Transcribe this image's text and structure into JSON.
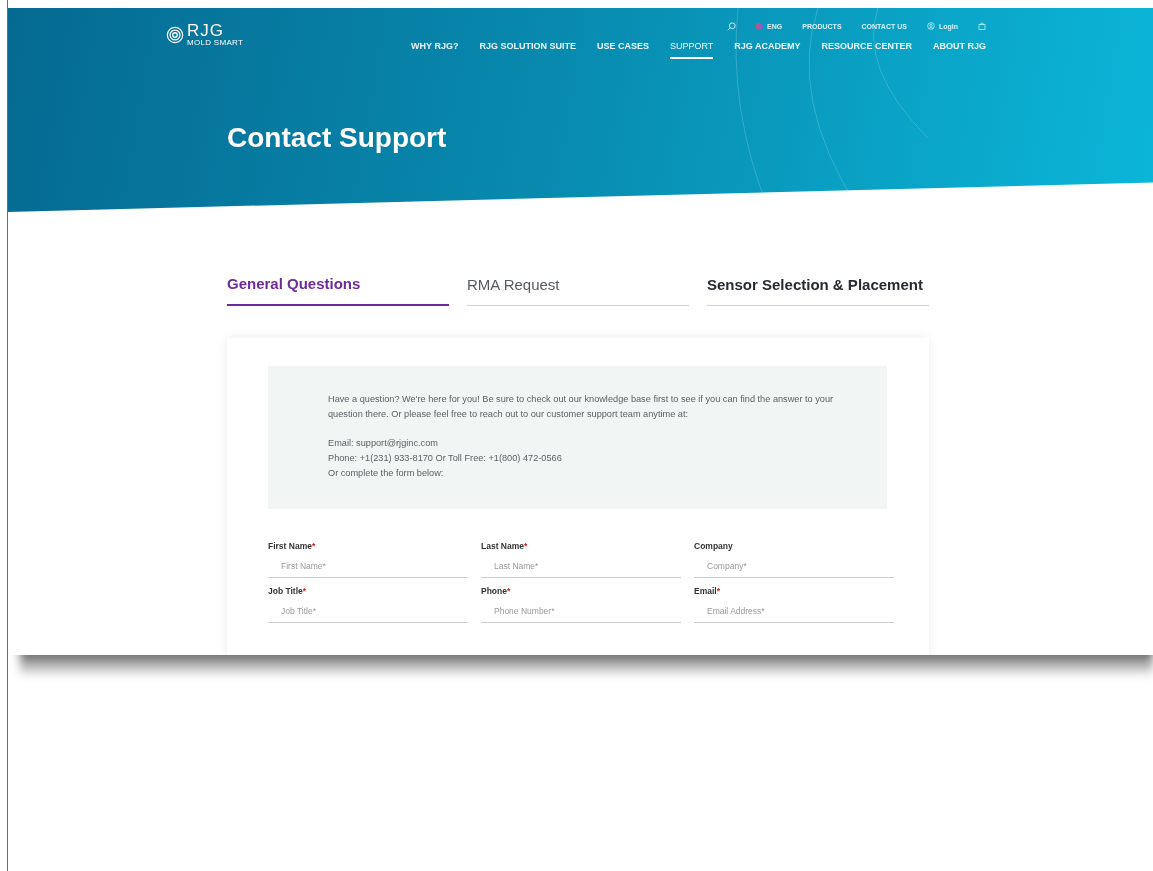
{
  "header": {
    "logo": {
      "name": "RJG",
      "tagline": "MOLD SMART"
    },
    "utility": [
      {
        "kind": "search"
      },
      {
        "kind": "language",
        "label": "ENG"
      },
      {
        "kind": "link",
        "label": "PRODUCTS"
      },
      {
        "kind": "link",
        "label": "CONTACT US"
      },
      {
        "kind": "login",
        "label": "Login"
      },
      {
        "kind": "cart"
      }
    ],
    "nav": [
      {
        "label": "WHY RJG?",
        "selected": false
      },
      {
        "label": "RJG SOLUTION SUITE",
        "selected": false
      },
      {
        "label": "USE CASES",
        "selected": false
      },
      {
        "label": "SUPPORT",
        "selected": true
      },
      {
        "label": "RJG ACADEMY",
        "selected": false
      },
      {
        "label": "RESOURCE CENTER",
        "selected": false
      },
      {
        "label": "ABOUT RJG",
        "selected": false
      }
    ]
  },
  "hero": {
    "title": "Contact Support"
  },
  "tabs": [
    {
      "label": "General Questions",
      "selected": true,
      "bold": true
    },
    {
      "label": "RMA Request",
      "selected": false,
      "bold": false
    },
    {
      "label": "Sensor Selection & Placement",
      "selected": false,
      "bold": true
    }
  ],
  "intro": {
    "lines": [
      "Have a question? We're here for you! Be sure to check out our knowledge base first to see if you can find the answer to your question there. Or please feel free to reach out to our customer support team anytime at:",
      "Email: support@rjginc.com\nPhone: +1(231) 933-8170 Or Toll Free: +1(800) 472-0566\nOr complete the form below:"
    ]
  },
  "form": {
    "fields": [
      {
        "label": "First Name",
        "mark": "*",
        "placeholder": "First Name*"
      },
      {
        "label": "Last Name",
        "mark": "*",
        "placeholder": "Last Name*"
      },
      {
        "label": "Company",
        "placeholder": "Company*"
      },
      {
        "label": "Job Title",
        "mark": "*",
        "placeholder": "Job Title*"
      },
      {
        "label": "Phone",
        "mark": "*",
        "placeholder": "Phone Number*"
      },
      {
        "label": "Email",
        "mark": "*",
        "placeholder": "Email Address*"
      }
    ]
  }
}
